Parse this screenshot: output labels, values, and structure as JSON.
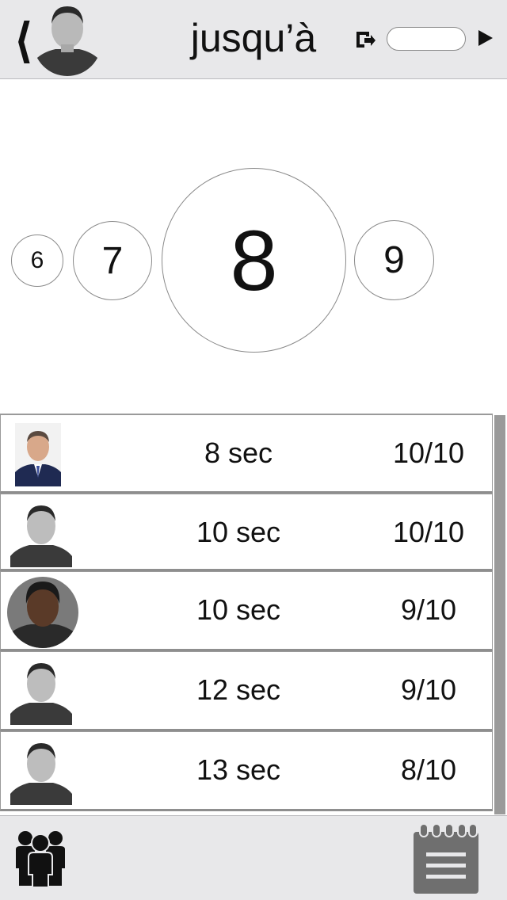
{
  "header": {
    "title": "jusqu’à",
    "back_icon": "chevron-left-icon",
    "action_icon": "exit-arrow-icon",
    "input_value": "",
    "play_icon": "play-icon"
  },
  "selector": {
    "values": [
      "6",
      "7",
      "8",
      "9"
    ],
    "selected": "8"
  },
  "results": [
    {
      "time": "8 sec",
      "score": "10/10"
    },
    {
      "time": "10 sec",
      "score": "10/10"
    },
    {
      "time": "10 sec",
      "score": "9/10"
    },
    {
      "time": "12 sec",
      "score": "9/10"
    },
    {
      "time": "13 sec",
      "score": "8/10"
    }
  ],
  "footer": {
    "left_icon": "people-group-icon",
    "right_icon": "notepad-icon"
  },
  "colors": {
    "bar_background": "#e8e8ea",
    "scroll_thumb": "#9a9a9a"
  }
}
